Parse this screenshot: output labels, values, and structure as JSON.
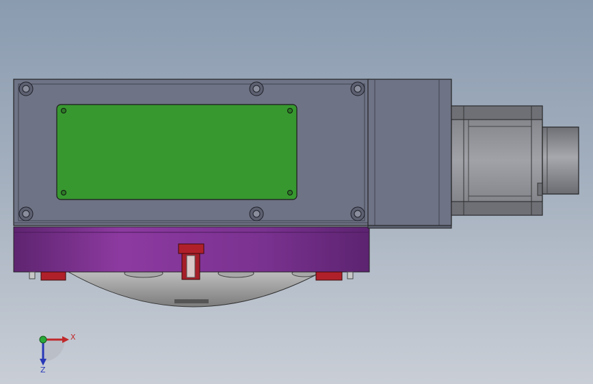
{
  "viewport": {
    "background_top": "#8a9bb0",
    "background_bottom": "#c9ced6"
  },
  "colors": {
    "housing": "#6e7385",
    "housing_dark": "#4e5262",
    "nameplate": "#37982f",
    "base_ring": "#7f3590",
    "red_parts": "#b0202a",
    "motor": "#8a8c92",
    "shaft": "#8d8f94",
    "dome": "#9a9a9a"
  },
  "triad": {
    "x_label": "X",
    "z_label": "Z",
    "x_color": "#c0282a",
    "y_color": "#2aa838",
    "z_color": "#2838b8"
  }
}
